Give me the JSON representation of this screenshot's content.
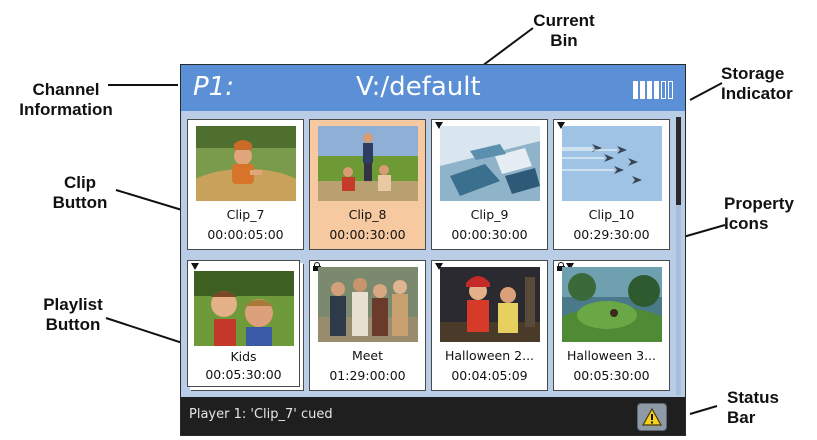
{
  "callouts": {
    "current_bin": "Current\nBin",
    "channel_information": "Channel\nInformation",
    "storage_indicator": "Storage\nIndicator",
    "clip_button": "Clip\nButton",
    "property_icons": "Property\nIcons",
    "playlist_button": "Playlist\nButton",
    "status_bar": "Status\nBar"
  },
  "header": {
    "channel": "P1:",
    "bin": "V:/default",
    "storage_bars": {
      "filled": 4,
      "total": 6
    }
  },
  "tiles": [
    {
      "name": "Clip_7",
      "duration": "00:00:05:00",
      "selected": false,
      "playlist": false,
      "lock": false,
      "marker": false,
      "thumb": "child-in-hay"
    },
    {
      "name": "Clip_8",
      "duration": "00:00:30:00",
      "selected": true,
      "playlist": false,
      "lock": false,
      "marker": false,
      "thumb": "family-in-field"
    },
    {
      "name": "Clip_9",
      "duration": "00:00:30:00",
      "selected": false,
      "playlist": false,
      "lock": false,
      "marker": true,
      "thumb": "aerial-city"
    },
    {
      "name": "Clip_10",
      "duration": "00:29:30:00",
      "selected": false,
      "playlist": false,
      "lock": false,
      "marker": true,
      "thumb": "jets-formation"
    },
    {
      "name": "Kids",
      "duration": "00:05:30:00",
      "selected": false,
      "playlist": true,
      "lock": false,
      "marker": true,
      "thumb": "kids-playing"
    },
    {
      "name": "Meet",
      "duration": "01:29:00:00",
      "selected": false,
      "playlist": false,
      "lock": true,
      "marker": false,
      "thumb": "group-people"
    },
    {
      "name": "Halloween 2...",
      "duration": "00:04:05:09",
      "selected": false,
      "playlist": false,
      "lock": false,
      "marker": true,
      "thumb": "costume-kids"
    },
    {
      "name": "Halloween 3...",
      "duration": "00:05:30:00",
      "selected": false,
      "playlist": false,
      "lock": true,
      "marker": true,
      "thumb": "fantasy-hill"
    }
  ],
  "statusbar": {
    "message": "Player 1: 'Clip_7' cued",
    "warning_icon": "warning-icon"
  }
}
